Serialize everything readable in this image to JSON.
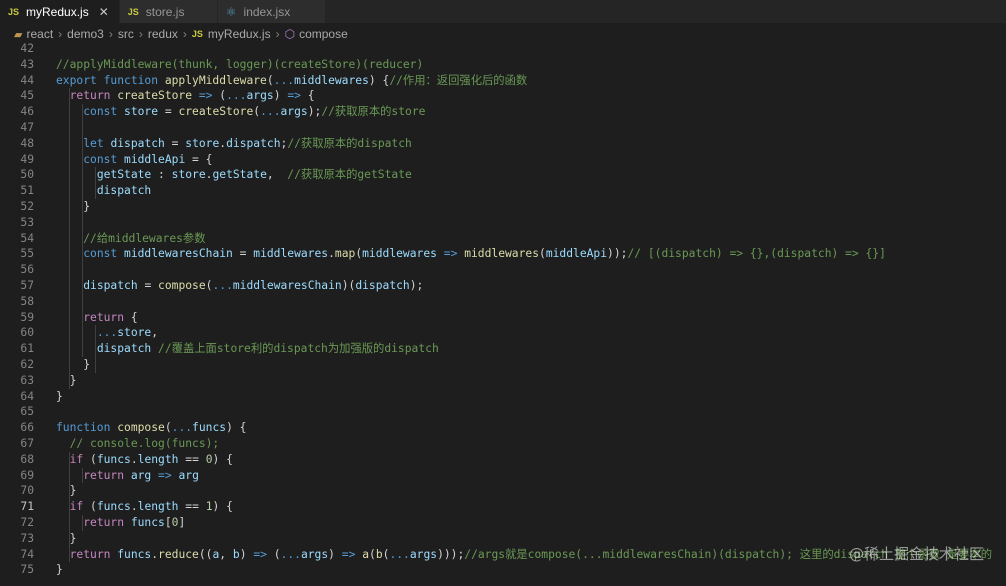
{
  "tabs": [
    {
      "label": "myRedux.js",
      "type": "JS",
      "active": true
    },
    {
      "label": "store.js",
      "type": "JS",
      "active": false
    },
    {
      "label": "index.jsx",
      "type": "react",
      "active": false
    }
  ],
  "breadcrumb": [
    "react",
    "demo3",
    "src",
    "redux",
    "myRedux.js",
    "compose"
  ],
  "watermark": "@稀土掘金技术社区",
  "current_line": "71",
  "lines": [
    {
      "n": "42",
      "t": []
    },
    {
      "n": "43",
      "t": [
        [
          "cm",
          "//applyMiddleware(thunk, logger)(createStore)(reducer)"
        ]
      ]
    },
    {
      "n": "44",
      "t": [
        [
          "kw",
          "export "
        ],
        [
          "kw",
          "function "
        ],
        [
          "fn",
          "applyMiddleware"
        ],
        [
          "p",
          "("
        ],
        [
          "kw",
          "..."
        ],
        [
          "var",
          "middlewares"
        ],
        [
          "p",
          ") {"
        ],
        [
          "cm",
          "//作用：返回强化后的函数"
        ]
      ]
    },
    {
      "n": "45",
      "t": [
        [
          "p",
          "  "
        ],
        [
          "ctl",
          "return "
        ],
        [
          "fn",
          "createStore"
        ],
        [
          "p",
          " "
        ],
        [
          "kw",
          "=>"
        ],
        [
          "p",
          " ("
        ],
        [
          "kw",
          "..."
        ],
        [
          "var",
          "args"
        ],
        [
          "p",
          ") "
        ],
        [
          "kw",
          "=>"
        ],
        [
          "p",
          " {"
        ]
      ]
    },
    {
      "n": "46",
      "t": [
        [
          "p",
          "    "
        ],
        [
          "kw",
          "const "
        ],
        [
          "var",
          "store"
        ],
        [
          "p",
          " = "
        ],
        [
          "fn",
          "createStore"
        ],
        [
          "p",
          "("
        ],
        [
          "kw",
          "..."
        ],
        [
          "var",
          "args"
        ],
        [
          "p",
          ");"
        ],
        [
          "cm",
          "//获取原本的store"
        ]
      ]
    },
    {
      "n": "47",
      "t": []
    },
    {
      "n": "48",
      "t": [
        [
          "p",
          "    "
        ],
        [
          "kw",
          "let "
        ],
        [
          "var",
          "dispatch"
        ],
        [
          "p",
          " = "
        ],
        [
          "var",
          "store"
        ],
        [
          "p",
          "."
        ],
        [
          "var",
          "dispatch"
        ],
        [
          "p",
          ";"
        ],
        [
          "cm",
          "//获取原本的dispatch"
        ]
      ]
    },
    {
      "n": "49",
      "t": [
        [
          "p",
          "    "
        ],
        [
          "kw",
          "const "
        ],
        [
          "var",
          "middleApi"
        ],
        [
          "p",
          " = {"
        ]
      ]
    },
    {
      "n": "50",
      "t": [
        [
          "p",
          "      "
        ],
        [
          "var",
          "getState"
        ],
        [
          "p",
          " : "
        ],
        [
          "var",
          "store"
        ],
        [
          "p",
          "."
        ],
        [
          "var",
          "getState"
        ],
        [
          "p",
          ",  "
        ],
        [
          "cm",
          "//获取原本的getState"
        ]
      ]
    },
    {
      "n": "51",
      "t": [
        [
          "p",
          "      "
        ],
        [
          "var",
          "dispatch"
        ]
      ]
    },
    {
      "n": "52",
      "t": [
        [
          "p",
          "    }"
        ]
      ]
    },
    {
      "n": "53",
      "t": []
    },
    {
      "n": "54",
      "t": [
        [
          "p",
          "    "
        ],
        [
          "cm",
          "//给middlewares参数"
        ]
      ]
    },
    {
      "n": "55",
      "t": [
        [
          "p",
          "    "
        ],
        [
          "kw",
          "const "
        ],
        [
          "var",
          "middlewaresChain"
        ],
        [
          "p",
          " = "
        ],
        [
          "var",
          "middlewares"
        ],
        [
          "p",
          "."
        ],
        [
          "fn",
          "map"
        ],
        [
          "p",
          "("
        ],
        [
          "var",
          "middlewares"
        ],
        [
          "p",
          " "
        ],
        [
          "kw",
          "=>"
        ],
        [
          "p",
          " "
        ],
        [
          "fn",
          "middlewares"
        ],
        [
          "p",
          "("
        ],
        [
          "var",
          "middleApi"
        ],
        [
          "p",
          "));"
        ],
        [
          "cm",
          "// [(dispatch) => {},(dispatch) => {}]"
        ]
      ]
    },
    {
      "n": "56",
      "t": []
    },
    {
      "n": "57",
      "t": [
        [
          "p",
          "    "
        ],
        [
          "var",
          "dispatch"
        ],
        [
          "p",
          " = "
        ],
        [
          "fn",
          "compose"
        ],
        [
          "p",
          "("
        ],
        [
          "kw",
          "..."
        ],
        [
          "var",
          "middlewaresChain"
        ],
        [
          "p",
          ")("
        ],
        [
          "var",
          "dispatch"
        ],
        [
          "p",
          ");"
        ]
      ]
    },
    {
      "n": "58",
      "t": []
    },
    {
      "n": "59",
      "t": [
        [
          "p",
          "    "
        ],
        [
          "ctl",
          "return"
        ],
        [
          "p",
          " {"
        ]
      ]
    },
    {
      "n": "60",
      "t": [
        [
          "p",
          "      "
        ],
        [
          "kw",
          "..."
        ],
        [
          "var",
          "store"
        ],
        [
          "p",
          ","
        ]
      ]
    },
    {
      "n": "61",
      "t": [
        [
          "p",
          "      "
        ],
        [
          "var",
          "dispatch"
        ],
        [
          "p",
          " "
        ],
        [
          "cm",
          "//覆盖上面store利的dispatch为加强版的dispatch"
        ]
      ]
    },
    {
      "n": "62",
      "t": [
        [
          "p",
          "    }"
        ]
      ]
    },
    {
      "n": "63",
      "t": [
        [
          "p",
          "  }"
        ]
      ]
    },
    {
      "n": "64",
      "t": [
        [
          "p",
          "}"
        ]
      ]
    },
    {
      "n": "65",
      "t": []
    },
    {
      "n": "66",
      "t": [
        [
          "kw",
          "function "
        ],
        [
          "fn",
          "compose"
        ],
        [
          "p",
          "("
        ],
        [
          "kw",
          "..."
        ],
        [
          "var",
          "funcs"
        ],
        [
          "p",
          ") {"
        ]
      ]
    },
    {
      "n": "67",
      "t": [
        [
          "p",
          "  "
        ],
        [
          "cm",
          "// console.log(funcs);"
        ]
      ]
    },
    {
      "n": "68",
      "t": [
        [
          "p",
          "  "
        ],
        [
          "ctl",
          "if"
        ],
        [
          "p",
          " ("
        ],
        [
          "var",
          "funcs"
        ],
        [
          "p",
          "."
        ],
        [
          "var",
          "length"
        ],
        [
          "p",
          " == "
        ],
        [
          "num",
          "0"
        ],
        [
          "p",
          ") {"
        ]
      ]
    },
    {
      "n": "69",
      "t": [
        [
          "p",
          "    "
        ],
        [
          "ctl",
          "return "
        ],
        [
          "var",
          "arg"
        ],
        [
          "p",
          " "
        ],
        [
          "kw",
          "=>"
        ],
        [
          "p",
          " "
        ],
        [
          "var",
          "arg"
        ]
      ]
    },
    {
      "n": "70",
      "t": [
        [
          "p",
          "  }"
        ]
      ]
    },
    {
      "n": "71",
      "t": [
        [
          "p",
          "  "
        ],
        [
          "ctl",
          "if"
        ],
        [
          "p",
          " ("
        ],
        [
          "var",
          "funcs"
        ],
        [
          "p",
          "."
        ],
        [
          "var",
          "length"
        ],
        [
          "p",
          " == "
        ],
        [
          "num",
          "1"
        ],
        [
          "p",
          ") {"
        ]
      ]
    },
    {
      "n": "72",
      "t": [
        [
          "p",
          "    "
        ],
        [
          "ctl",
          "return "
        ],
        [
          "var",
          "funcs"
        ],
        [
          "p",
          "["
        ],
        [
          "num",
          "0"
        ],
        [
          "p",
          "]"
        ]
      ]
    },
    {
      "n": "73",
      "t": [
        [
          "p",
          "  }"
        ]
      ]
    },
    {
      "n": "74",
      "t": [
        [
          "p",
          "  "
        ],
        [
          "ctl",
          "return "
        ],
        [
          "var",
          "funcs"
        ],
        [
          "p",
          "."
        ],
        [
          "fn",
          "reduce"
        ],
        [
          "p",
          "(("
        ],
        [
          "var",
          "a"
        ],
        [
          "p",
          ", "
        ],
        [
          "var",
          "b"
        ],
        [
          "p",
          ") "
        ],
        [
          "kw",
          "=>"
        ],
        [
          "p",
          " ("
        ],
        [
          "kw",
          "..."
        ],
        [
          "var",
          "args"
        ],
        [
          "p",
          ") "
        ],
        [
          "kw",
          "=>"
        ],
        [
          "p",
          " "
        ],
        [
          "fn",
          "a"
        ],
        [
          "p",
          "("
        ],
        [
          "fn",
          "b"
        ],
        [
          "p",
          "("
        ],
        [
          "kw",
          "..."
        ],
        [
          "var",
          "args"
        ],
        [
          "p",
          ")));"
        ],
        [
          "cm",
          "//args就是compose(...middlewaresChain)(dispatch); 这里的dispatch 整个函数 是要本的"
        ]
      ]
    },
    {
      "n": "75",
      "t": [
        [
          "p",
          "}"
        ]
      ]
    }
  ]
}
